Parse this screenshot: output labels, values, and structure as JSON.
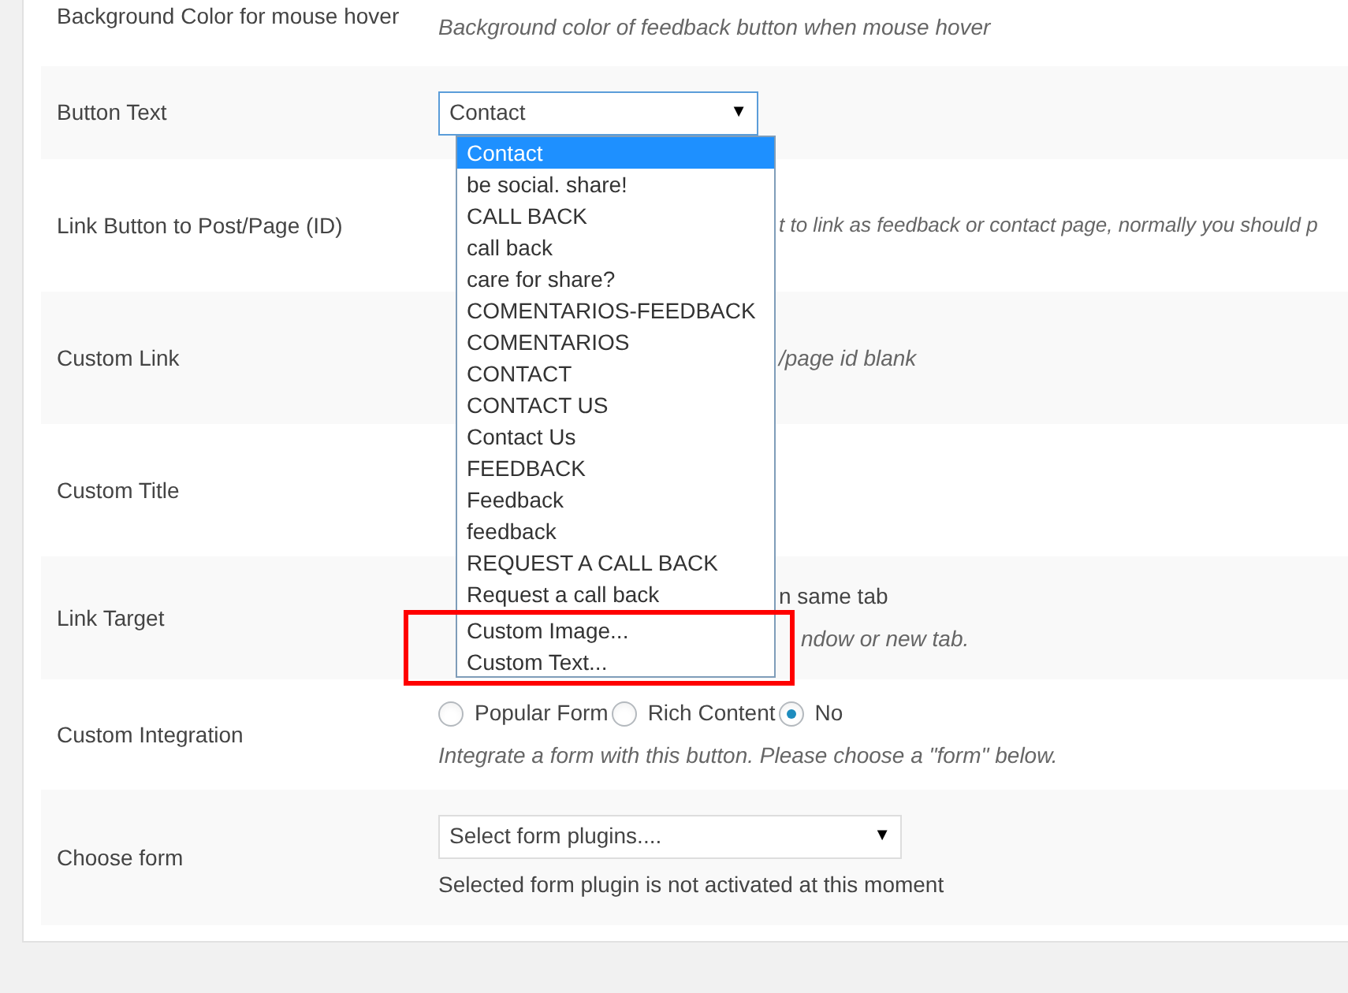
{
  "rows": [
    {
      "kind": "text",
      "label": "Background Color for mouse hover",
      "description": "Background color of feedback button when mouse hover"
    },
    {
      "kind": "select",
      "label": "Button Text",
      "value": "Contact",
      "arrow": "▼",
      "expanded": true
    },
    {
      "kind": "text",
      "label": "Link Button to Post/Page (ID)",
      "description": "t to link as feedback or contact page, normally you should p"
    },
    {
      "kind": "text",
      "label": "Custom Link",
      "description": "/page id blank"
    },
    {
      "kind": "text",
      "label": "Custom Title"
    },
    {
      "kind": "target",
      "label": "Link Target",
      "option": "n same tab",
      "description": "ndow or new tab."
    },
    {
      "kind": "radios",
      "label": "Custom Integration",
      "options": [
        {
          "label": "Popular Form",
          "selected": false
        },
        {
          "label": "Rich Content",
          "selected": false
        },
        {
          "label": "No",
          "selected": true
        }
      ],
      "description": "Integrate a form with this button. Please choose a \"form\" below."
    },
    {
      "kind": "plainselect",
      "label": "Choose form",
      "value": "Select form plugins....",
      "arrow": "▼",
      "note": "Selected form plugin is not activated at this moment"
    }
  ],
  "dropdown": {
    "options": [
      {
        "label": "Contact",
        "selected": true
      },
      {
        "label": "be social. share!",
        "selected": false
      },
      {
        "label": "CALL BACK",
        "selected": false
      },
      {
        "label": "call back",
        "selected": false
      },
      {
        "label": "care for share?",
        "selected": false
      },
      {
        "label": "COMENTARIOS-FEEDBACK",
        "selected": false
      },
      {
        "label": "COMENTARIOS",
        "selected": false
      },
      {
        "label": "CONTACT",
        "selected": false
      },
      {
        "label": "CONTACT US",
        "selected": false
      },
      {
        "label": "Contact Us",
        "selected": false
      },
      {
        "label": "FEEDBACK",
        "selected": false
      },
      {
        "label": "Feedback",
        "selected": false
      },
      {
        "label": "feedback",
        "selected": false
      },
      {
        "label": "REQUEST A CALL BACK",
        "selected": false
      },
      {
        "label": "Request a call back",
        "selected": false
      }
    ],
    "framed_options": [
      {
        "label": "Custom Image...",
        "selected": false
      },
      {
        "label": "Custom Text...",
        "selected": false
      }
    ]
  }
}
